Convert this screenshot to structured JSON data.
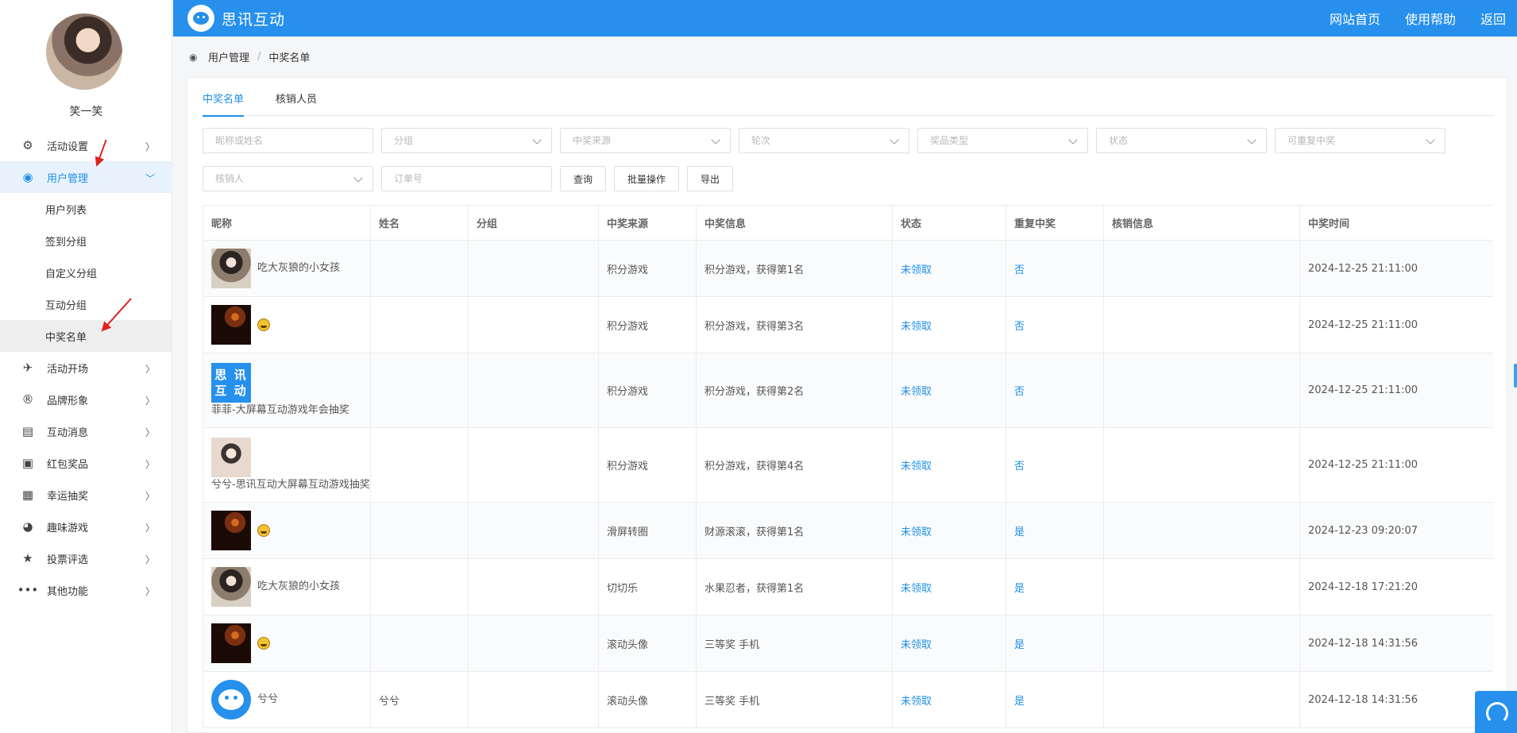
{
  "sidebar": {
    "username": "笑一笑",
    "menu": [
      {
        "label": "活动设置",
        "icon": "gear-icon"
      },
      {
        "label": "用户管理",
        "icon": "user-lock-icon"
      },
      {
        "label": "活动开场",
        "icon": "paper-plane-icon"
      },
      {
        "label": "品牌形象",
        "icon": "registered-icon"
      },
      {
        "label": "互动消息",
        "icon": "chat-icon"
      },
      {
        "label": "红包奖品",
        "icon": "gift-icon"
      },
      {
        "label": "幸运抽奖",
        "icon": "dashboard-icon"
      },
      {
        "label": "趣味游戏",
        "icon": "pacman-icon"
      },
      {
        "label": "投票评选",
        "icon": "star-icon"
      },
      {
        "label": "其他功能",
        "icon": "more-icon"
      }
    ],
    "submenu": [
      "用户列表",
      "签到分组",
      "自定义分组",
      "互动分组",
      "中奖名单"
    ]
  },
  "header": {
    "brand": "思讯互动",
    "links": [
      "网站首页",
      "使用帮助",
      "返回"
    ]
  },
  "breadcrumb": [
    "用户管理",
    "中奖名单"
  ],
  "tabs": [
    "中奖名单",
    "核销人员"
  ],
  "filters": {
    "row1": [
      "昵称或姓名",
      "分组",
      "中奖来源",
      "轮次",
      "奖品类型",
      "状态",
      "可重复中奖"
    ],
    "row2_select": "核销人",
    "row2_input": "订单号",
    "buttons": [
      "查询",
      "批量操作",
      "导出"
    ]
  },
  "table": {
    "headers": [
      "昵称",
      "姓名",
      "分组",
      "中奖来源",
      "中奖信息",
      "状态",
      "重复中奖",
      "核销信息",
      "中奖时间"
    ],
    "rows": [
      {
        "nick": "吃大灰狼的小女孩",
        "name": "",
        "group": "",
        "source": "积分游戏",
        "info": "积分游戏，获得第1名",
        "status": "未领取",
        "repeat": "否",
        "verify": "",
        "time": "2024-12-25 21:11:00"
      },
      {
        "nick": "",
        "name": "",
        "group": "",
        "source": "积分游戏",
        "info": "积分游戏，获得第3名",
        "status": "未领取",
        "repeat": "否",
        "verify": "",
        "time": "2024-12-25 21:11:00"
      },
      {
        "nick": "菲菲-大屏幕互动游戏年会抽奖",
        "name": "",
        "group": "",
        "source": "积分游戏",
        "info": "积分游戏，获得第2名",
        "status": "未领取",
        "repeat": "否",
        "verify": "",
        "time": "2024-12-25 21:11:00"
      },
      {
        "nick": "兮兮-思讯互动大屏幕互动游戏抽奖",
        "name": "",
        "group": "",
        "source": "积分游戏",
        "info": "积分游戏，获得第4名",
        "status": "未领取",
        "repeat": "否",
        "verify": "",
        "time": "2024-12-25 21:11:00"
      },
      {
        "nick": "",
        "name": "",
        "group": "",
        "source": "滑屏转圈",
        "info": "财源滚滚，获得第1名",
        "status": "未领取",
        "repeat": "是",
        "verify": "",
        "time": "2024-12-23 09:20:07"
      },
      {
        "nick": "吃大灰狼的小女孩",
        "name": "",
        "group": "",
        "source": "切切乐",
        "info": "水果忍者，获得第1名",
        "status": "未领取",
        "repeat": "是",
        "verify": "",
        "time": "2024-12-18 17:21:20"
      },
      {
        "nick": "",
        "name": "",
        "group": "",
        "source": "滚动头像",
        "info": "三等奖 手机",
        "status": "未领取",
        "repeat": "是",
        "verify": "",
        "time": "2024-12-18 14:31:56"
      },
      {
        "nick": "兮兮",
        "name": "兮兮",
        "group": "",
        "source": "滚动头像",
        "info": "三等奖 手机",
        "status": "未领取",
        "repeat": "是",
        "verify": "",
        "time": "2024-12-18 14:31:56"
      }
    ]
  },
  "brand_thumb_text": [
    "思 讯",
    "互 动"
  ],
  "colors": {
    "primary": "#2690ec",
    "link": "#1e8fe8",
    "alert_arrow": "#e02020"
  }
}
